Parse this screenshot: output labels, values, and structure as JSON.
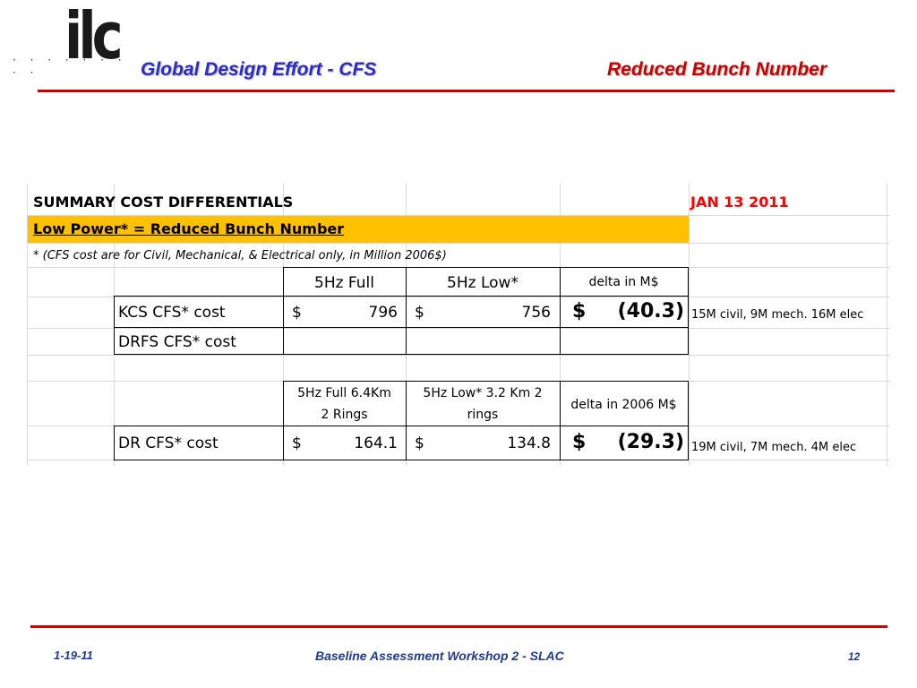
{
  "header": {
    "logo_text": "ilc",
    "logo_dots": "· · · · · · · · ·",
    "title": "Global Design Effort  - CFS",
    "section": "Reduced Bunch Number"
  },
  "sheet": {
    "summary_title": "SUMMARY COST DIFFERENTIALS",
    "date": "JAN 13 2011",
    "highlight": "Low Power* = Reduced Bunch Number",
    "note": "* (CFS cost are for Civil, Mechanical, & Electrical only, in Million 2006$)",
    "table1": {
      "headers": [
        "5Hz Full",
        "5Hz Low*",
        "delta in M$"
      ],
      "rows": [
        {
          "label": "KCS CFS* cost",
          "cur1": "$",
          "v1": "796",
          "cur2": "$",
          "v2": "756",
          "dcur": "$",
          "delta": "(40.3)",
          "comment": "15M civil, 9M mech. 16M elec"
        },
        {
          "label": "DRFS CFS* cost"
        }
      ]
    },
    "table2": {
      "headers": [
        {
          "line1": "5Hz Full 6.4Km",
          "line2": "2 Rings"
        },
        {
          "line1": "5Hz Low* 3.2 Km 2",
          "line2": "rings"
        },
        {
          "line1": "delta in 2006 M$",
          "line2": ""
        }
      ],
      "row": {
        "label": "DR CFS* cost",
        "cur1": "$",
        "v1": "164.1",
        "cur2": "$",
        "v2": "134.8",
        "dcur": "$",
        "delta": "(29.3)",
        "comment": "19M civil, 7M mech. 4M elec"
      }
    }
  },
  "footer": {
    "date": "1-19-11",
    "event": "Baseline Assessment Workshop 2  -  SLAC",
    "page": "12"
  },
  "colors": {
    "accent_red": "#cc0000",
    "title_blue": "#2b2bc8",
    "highlight": "#ffc000"
  }
}
